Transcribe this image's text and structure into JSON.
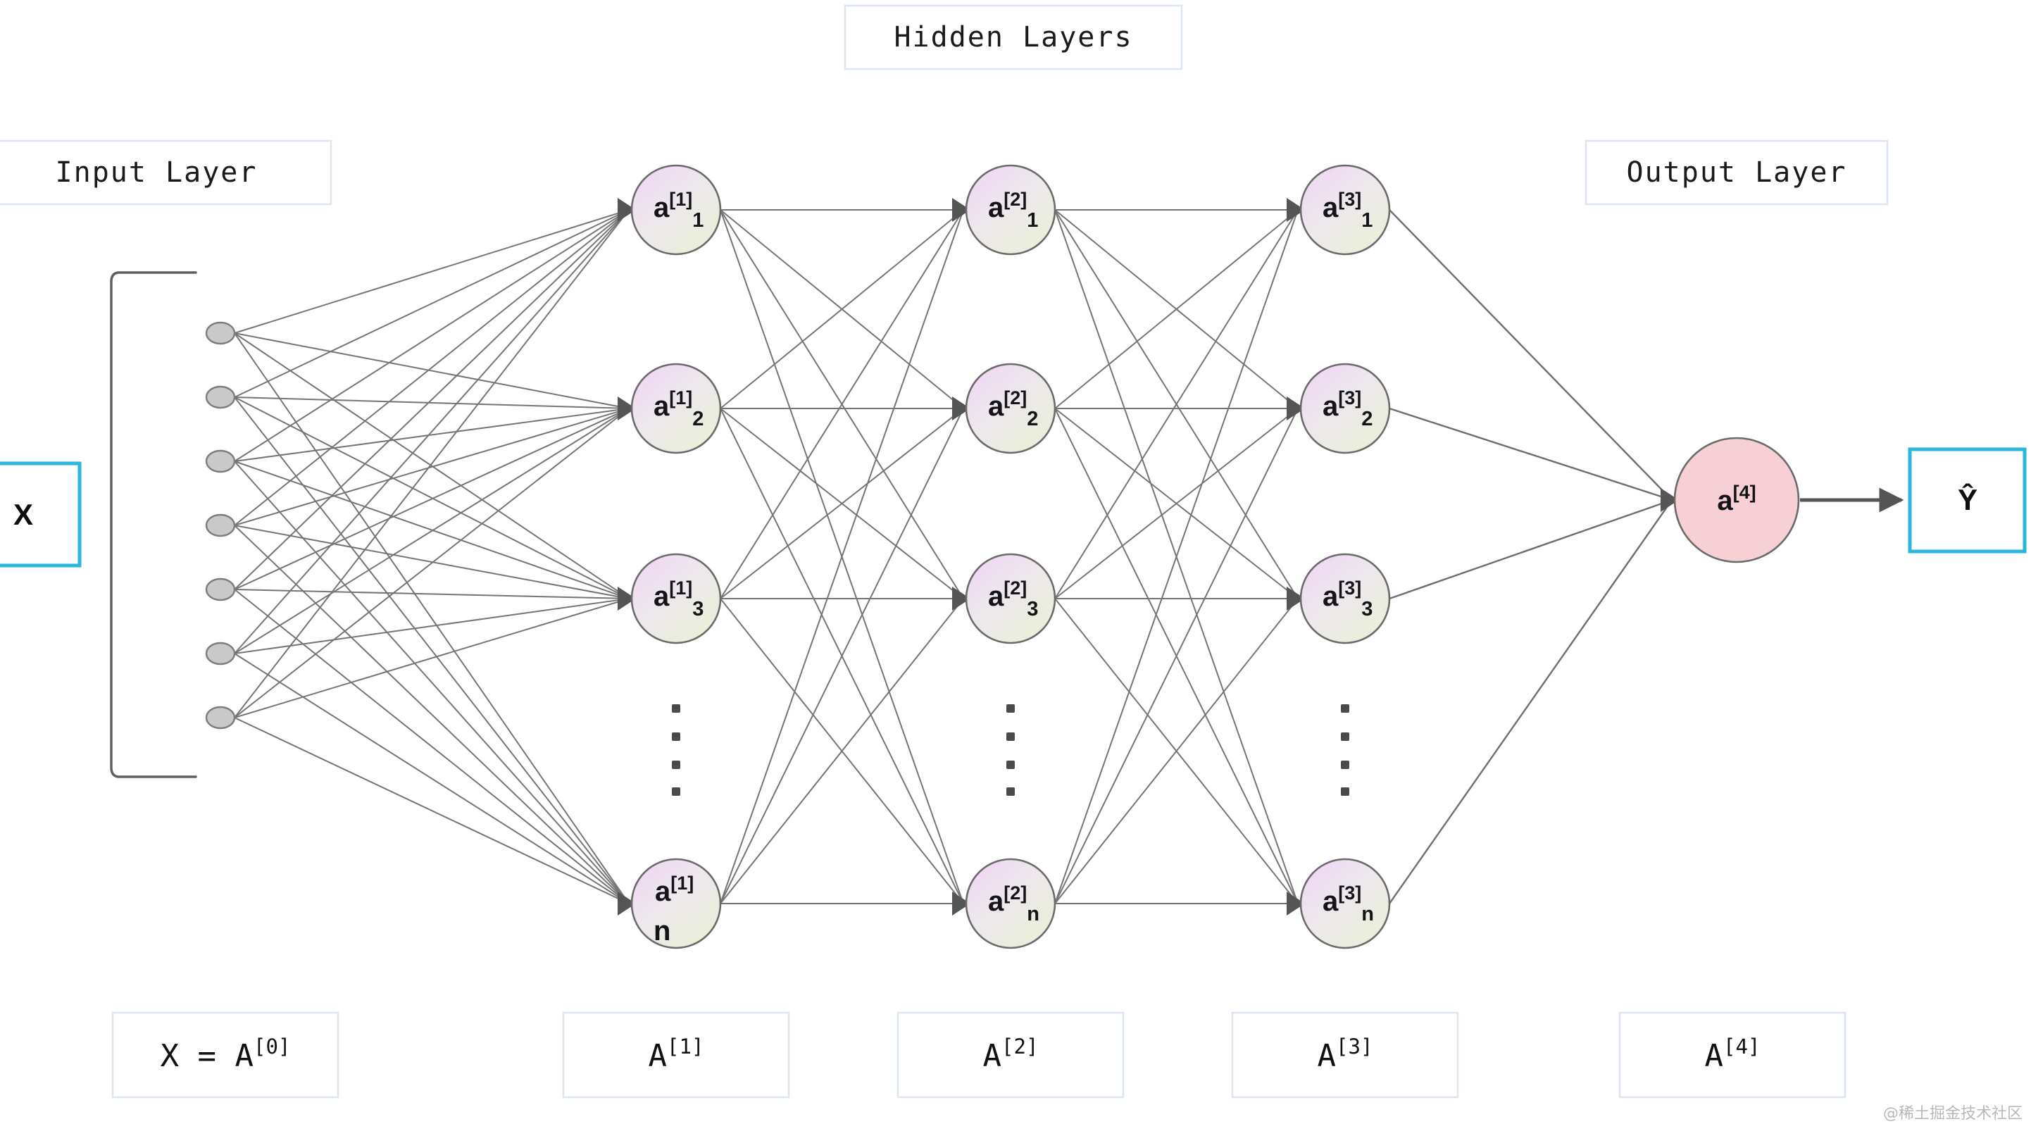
{
  "diagram": {
    "title_boxes": [
      {
        "id": "hidden-layers",
        "label": "Hidden Layers"
      },
      {
        "id": "input-layer",
        "label": "Input Layer"
      },
      {
        "id": "output-layer",
        "label": "Output Layer"
      }
    ],
    "io_boxes": [
      {
        "id": "input-x",
        "label": "X"
      },
      {
        "id": "output-yhat",
        "label": "Ŷ"
      }
    ],
    "input_layer": {
      "node_count": 7,
      "bracket": "square-bracket"
    },
    "hidden_layers": [
      {
        "index": 1,
        "superscript": "[1]",
        "nodes": [
          {
            "base": "a",
            "sup": "[1]",
            "sub": "1"
          },
          {
            "base": "a",
            "sup": "[1]",
            "sub": "2"
          },
          {
            "base": "a",
            "sup": "[1]",
            "sub": "3"
          },
          {
            "base": "a",
            "sup": "[1]",
            "sub": "n",
            "wrapped": true
          }
        ],
        "ellipsis": "⁞"
      },
      {
        "index": 2,
        "superscript": "[2]",
        "nodes": [
          {
            "base": "a",
            "sup": "[2]",
            "sub": "1"
          },
          {
            "base": "a",
            "sup": "[2]",
            "sub": "2"
          },
          {
            "base": "a",
            "sup": "[2]",
            "sub": "3"
          },
          {
            "base": "a",
            "sup": "[2]",
            "sub": "n"
          }
        ],
        "ellipsis": "⁞"
      },
      {
        "index": 3,
        "superscript": "[3]",
        "nodes": [
          {
            "base": "a",
            "sup": "[3]",
            "sub": "1"
          },
          {
            "base": "a",
            "sup": "[3]",
            "sub": "2"
          },
          {
            "base": "a",
            "sup": "[3]",
            "sub": "3"
          },
          {
            "base": "a",
            "sup": "[3]",
            "sub": "n"
          }
        ],
        "ellipsis": "⁞"
      }
    ],
    "output_node": {
      "base": "a",
      "sup": "[4]",
      "sub": ""
    },
    "matrix_labels": [
      {
        "id": "A0",
        "text": "X = A",
        "sup": "[0]"
      },
      {
        "id": "A1",
        "text": "A",
        "sup": "[1]"
      },
      {
        "id": "A2",
        "text": "A",
        "sup": "[2]"
      },
      {
        "id": "A3",
        "text": "A",
        "sup": "[3]"
      },
      {
        "id": "A4",
        "text": "A",
        "sup": "[4]"
      }
    ],
    "watermark": "@稀土掘金技术社区",
    "colors": {
      "node_gradient_start": "#efd4f2",
      "node_gradient_end": "#eaf0d8",
      "node_stroke": "#6b6b6b",
      "output_node_fill": "#f6d0d4",
      "output_node_stroke": "#6b6b6b",
      "input_node_fill": "#c9c9c9",
      "input_node_stroke": "#7d7d7d",
      "edge": "#5e5e5e",
      "arrowhead": "#555555",
      "accent_cyan": "#2ab6dd",
      "box_border_light": "#dbe6f2",
      "text": "#1a1a1a",
      "background": "#ffffff"
    }
  }
}
